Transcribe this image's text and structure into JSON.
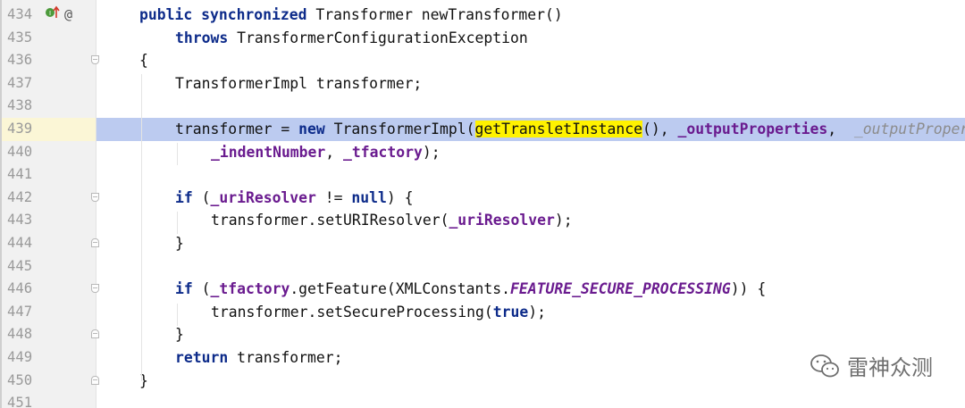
{
  "lines": [
    {
      "n": "434",
      "indent": 0,
      "tokens": [
        {
          "t": "kw",
          "v": "public"
        },
        {
          "t": "p",
          "v": " "
        },
        {
          "t": "kw",
          "v": "synchronized"
        },
        {
          "t": "p",
          "v": " Transformer newTransformer()"
        }
      ]
    },
    {
      "n": "435",
      "indent": 1,
      "tokens": [
        {
          "t": "kw",
          "v": "throws"
        },
        {
          "t": "p",
          "v": " TransformerConfigurationException"
        }
      ]
    },
    {
      "n": "436",
      "indent": 0,
      "tokens": [
        {
          "t": "p",
          "v": "{"
        }
      ]
    },
    {
      "n": "437",
      "indent": 1,
      "tokens": [
        {
          "t": "p",
          "v": "TransformerImpl transformer;"
        }
      ]
    },
    {
      "n": "438",
      "indent": 0,
      "tokens": []
    },
    {
      "n": "439",
      "indent": 1,
      "tokens": [
        {
          "t": "p",
          "v": "transformer = "
        },
        {
          "t": "kw",
          "v": "new"
        },
        {
          "t": "p",
          "v": " TransformerImpl("
        },
        {
          "t": "hl",
          "v": "getTransletInstance"
        },
        {
          "t": "p",
          "v": "(), "
        },
        {
          "t": "fld",
          "v": "_outputProperties"
        },
        {
          "t": "p",
          "v": ",  "
        },
        {
          "t": "hint",
          "v": "_outputProperties"
        }
      ]
    },
    {
      "n": "440",
      "indent": 2,
      "tokens": [
        {
          "t": "fld",
          "v": "_indentNumber"
        },
        {
          "t": "p",
          "v": ", "
        },
        {
          "t": "fld",
          "v": "_tfactory"
        },
        {
          "t": "p",
          "v": ");"
        }
      ]
    },
    {
      "n": "441",
      "indent": 0,
      "tokens": []
    },
    {
      "n": "442",
      "indent": 1,
      "tokens": [
        {
          "t": "kw",
          "v": "if"
        },
        {
          "t": "p",
          "v": " ("
        },
        {
          "t": "fld",
          "v": "_uriResolver"
        },
        {
          "t": "p",
          "v": " != "
        },
        {
          "t": "kw",
          "v": "null"
        },
        {
          "t": "p",
          "v": ") {"
        }
      ]
    },
    {
      "n": "443",
      "indent": 2,
      "tokens": [
        {
          "t": "p",
          "v": "transformer.setURIResolver("
        },
        {
          "t": "fld",
          "v": "_uriResolver"
        },
        {
          "t": "p",
          "v": ");"
        }
      ]
    },
    {
      "n": "444",
      "indent": 1,
      "tokens": [
        {
          "t": "p",
          "v": "}"
        }
      ]
    },
    {
      "n": "445",
      "indent": 0,
      "tokens": []
    },
    {
      "n": "446",
      "indent": 1,
      "tokens": [
        {
          "t": "kw",
          "v": "if"
        },
        {
          "t": "p",
          "v": " ("
        },
        {
          "t": "fld",
          "v": "_tfactory"
        },
        {
          "t": "p",
          "v": ".getFeature(XMLConstants."
        },
        {
          "t": "sfld",
          "v": "FEATURE_SECURE_PROCESSING"
        },
        {
          "t": "p",
          "v": ")) {"
        }
      ]
    },
    {
      "n": "447",
      "indent": 2,
      "tokens": [
        {
          "t": "p",
          "v": "transformer.setSecureProcessing("
        },
        {
          "t": "kw",
          "v": "true"
        },
        {
          "t": "p",
          "v": ");"
        }
      ]
    },
    {
      "n": "448",
      "indent": 1,
      "tokens": [
        {
          "t": "p",
          "v": "}"
        }
      ]
    },
    {
      "n": "449",
      "indent": 1,
      "tokens": [
        {
          "kw": 1,
          "t": "kw",
          "v": "return"
        },
        {
          "t": "p",
          "v": " transformer;"
        }
      ]
    },
    {
      "n": "450",
      "indent": 0,
      "tokens": [
        {
          "t": "p",
          "v": "}"
        }
      ]
    },
    {
      "n": "451",
      "indent": 0,
      "tokens": []
    }
  ],
  "current_line": "439",
  "gutter_icons": {
    "line": "434",
    "icons": [
      "implementation-icon",
      "override-up-arrow-icon",
      "annotation-at-icon"
    ],
    "at_symbol": "@"
  },
  "folds": {
    "open": [
      "436",
      "442",
      "446"
    ],
    "close": [
      "444",
      "448",
      "450"
    ]
  },
  "colors": {
    "keyword": "#0d2b8a",
    "field": "#6a1b8f",
    "hint": "#8c8c8c",
    "highlight": "#fff200",
    "current_line": "#bccbf0"
  },
  "watermark": {
    "text": "雷神众测",
    "icon": "wechat-icon"
  }
}
